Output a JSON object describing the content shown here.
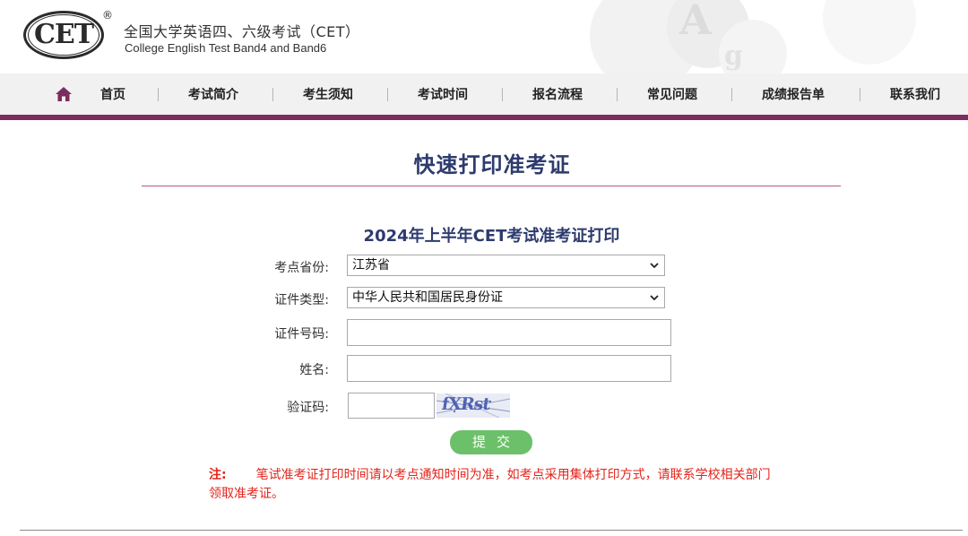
{
  "header": {
    "logo_text": "CET",
    "logo_reg": "®",
    "title_cn": "全国大学英语四、六级考试（CET）",
    "title_en": "College English Test Band4 and Band6"
  },
  "nav": {
    "home_icon": "home-icon",
    "items": [
      "首页",
      "考试简介",
      "考生须知",
      "考试时间",
      "报名流程",
      "常见问题",
      "成绩报告单",
      "联系我们"
    ]
  },
  "main": {
    "page_title": "快速打印准考证",
    "form_heading": "2024年上半年CET考试准考证打印",
    "form": {
      "province_label": "考点省份:",
      "province_value": "江苏省",
      "id_type_label": "证件类型:",
      "id_type_value": "中华人民共和国居民身份证",
      "id_number_label": "证件号码:",
      "id_number_value": "",
      "name_label": "姓名:",
      "name_value": "",
      "captcha_label": "验证码:",
      "captcha_value": "",
      "captcha_image_text": "fXRst",
      "submit_label": "提交"
    },
    "note": {
      "label": "注:",
      "text": "笔试准考证打印时间请以考点通知时间为准，如考点采用集体打印方式，请联系学校相关部门领取准考证。"
    }
  },
  "colors": {
    "nav_accent": "#7b2d5d",
    "title_color": "#2d3b6e",
    "button_green": "#6cc06a",
    "note_red": "#e3241b"
  }
}
